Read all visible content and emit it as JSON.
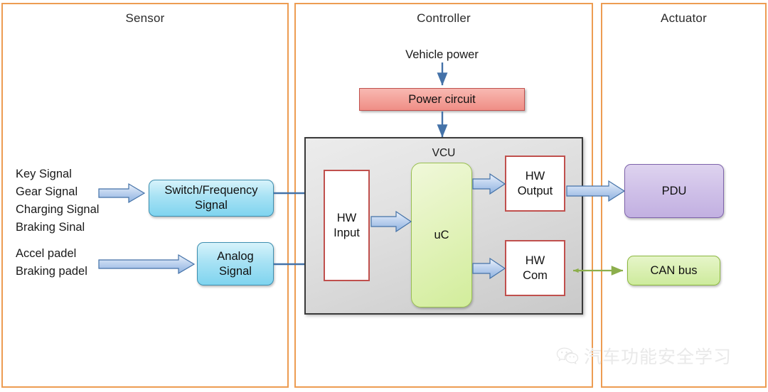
{
  "panels": [
    {
      "id": "sensor",
      "title": "Sensor"
    },
    {
      "id": "controller",
      "title": "Controller"
    },
    {
      "id": "actuator",
      "title": "Actuator"
    }
  ],
  "sensor": {
    "signal_group_1": [
      "Key Signal",
      "Gear Signal",
      "Charging Signal",
      "Braking Sinal"
    ],
    "signal_group_2": [
      "Accel padel",
      "Braking padel"
    ],
    "signal_group_1_text": "Key Signal\nGear Signal\nCharging Signal\nBraking Sinal",
    "signal_group_2_text": "Accel padel\nBraking padel",
    "boxes": {
      "switch_frequency": "Switch/Frequency Signal",
      "switch_frequency_line1": "Switch/Frequency",
      "switch_frequency_line2": "Signal",
      "analog_line1": "Analog",
      "analog_line2": "Signal"
    }
  },
  "controller": {
    "vehicle_power_label": "Vehicle power",
    "power_circuit_label": "Power circuit",
    "vcu": {
      "title": "VCU",
      "hw_input_line1": "HW",
      "hw_input_line2": "Input",
      "uc_label": "uC",
      "hw_output_line1": "HW",
      "hw_output_line2": "Output",
      "hw_com_line1": "HW",
      "hw_com_line2": "Com"
    }
  },
  "actuator": {
    "pdu_label": "PDU",
    "can_bus_label": "CAN bus"
  },
  "watermark": {
    "icon": "wechat-icon",
    "text": "汽车功能安全学习"
  },
  "colors": {
    "panel_border": "#ED9C52",
    "signal_box": "#a8e2f4",
    "power_circuit": "#f4a49c",
    "power_circuit_border": "#c0504d",
    "vcu_panel": "#e2e2e2",
    "vcu_panel_border": "#3a3a3a",
    "hw_box_border": "#c0504d",
    "uc_box": "#d2ed9b",
    "pdu_box": "#cfc0e8",
    "can_bus_box": "#d9efb0",
    "block_arrow": "#a8c3e8",
    "block_arrow_border": "#4472a8",
    "thin_arrow": "#4472a8",
    "can_arrow": "#8cae4c"
  }
}
